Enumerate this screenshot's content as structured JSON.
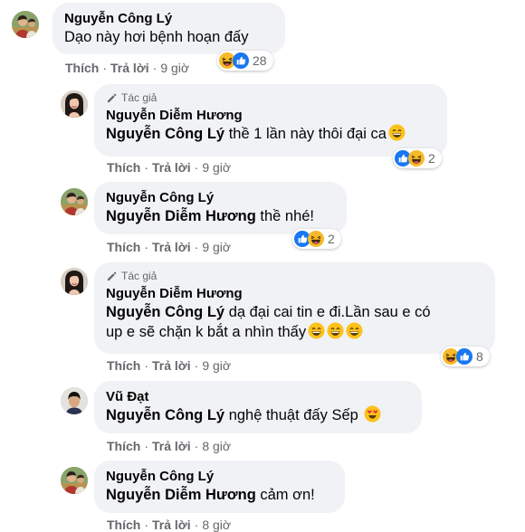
{
  "labels": {
    "like": "Thích",
    "reply": "Trả lời",
    "dot": "·",
    "author": "Tác giả"
  },
  "colors": {
    "bubble": "#f0f2f5",
    "meta": "#65676b",
    "text": "#050505",
    "like_blue": "#1877f2",
    "haha_yellow": "#f7b928"
  },
  "comments": [
    {
      "name": "Nguyễn Công Lý",
      "mention": "",
      "text": "Dạo này hơi bệnh hoạn đấy",
      "time": "9 giờ",
      "reactions": [
        "haha-icon",
        "like-icon"
      ],
      "reaction_count": "28"
    },
    {
      "author_badge": true,
      "name": "Nguyễn Diễm Hương",
      "mention": "Nguyễn Công Lý",
      "text": "thề 1 lần này thôi đại ca",
      "trailing_emoji": [
        "grin-icon"
      ],
      "time": "9 giờ",
      "reactions": [
        "like-icon",
        "haha-icon"
      ],
      "reaction_count": "2"
    },
    {
      "name": "Nguyễn Công Lý",
      "mention": "Nguyễn Diễm Hương",
      "text": "thề nhé!",
      "time": "9 giờ",
      "reactions": [
        "like-icon",
        "haha-icon"
      ],
      "reaction_count": "2"
    },
    {
      "author_badge": true,
      "name": "Nguyễn Diễm Hương",
      "mention": "Nguyễn Công Lý",
      "text": "dạ đại cai tin e đi.Lần sau e có",
      "text_line2": "up e sẽ chặn k bắt a nhìn thấy",
      "trailing_emoji": [
        "grin-icon",
        "grin-icon",
        "grin-icon"
      ],
      "time": "9 giờ",
      "reactions": [
        "haha-icon",
        "like-icon"
      ],
      "reaction_count": "8"
    },
    {
      "name": "Vũ Đạt",
      "mention": "Nguyễn Công Lý",
      "text": "nghệ thuật đấy Sếp",
      "trailing_emoji": [
        "heart-eyes-icon"
      ],
      "time": "8 giờ"
    },
    {
      "name": "Nguyễn Công Lý",
      "mention": "Nguyễn Diễm Hương",
      "text": "cảm ơn!",
      "time": "8 giờ"
    }
  ]
}
